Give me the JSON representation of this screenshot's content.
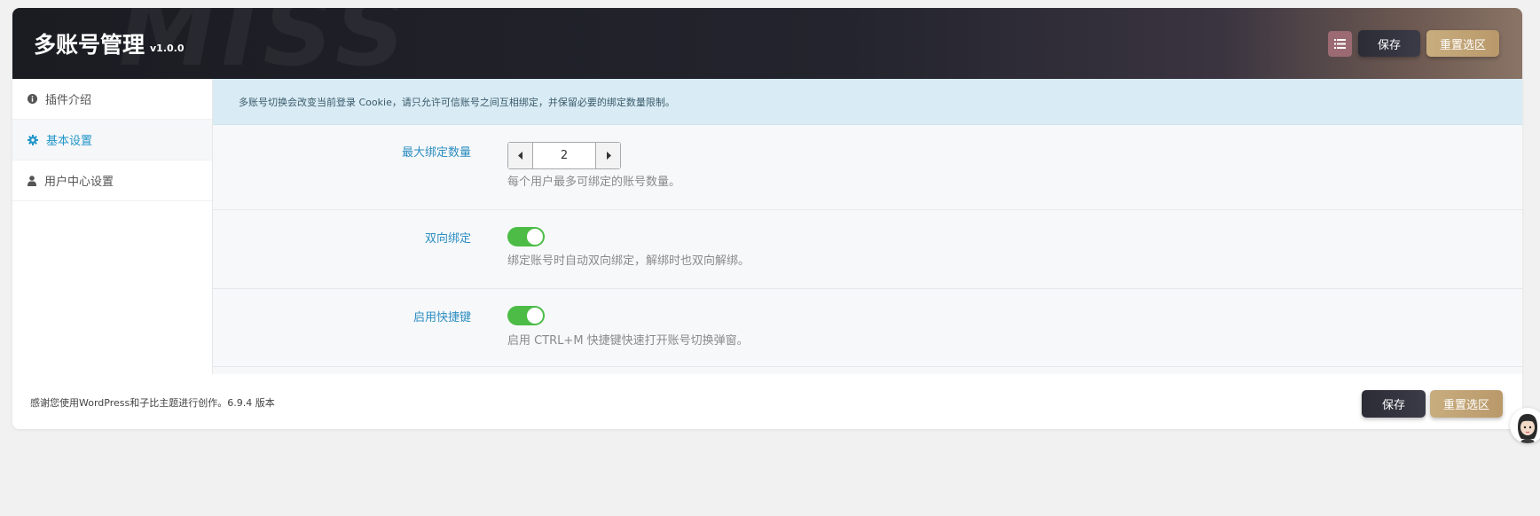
{
  "header": {
    "watermark": "MISS",
    "title": "多账号管理",
    "version": "v1.0.0",
    "save_label": "保存",
    "reset_label": "重置选区"
  },
  "sidebar": {
    "items": [
      {
        "label": "插件介绍",
        "icon": "info-circle-icon",
        "active": false
      },
      {
        "label": "基本设置",
        "icon": "gear-icon",
        "active": true
      },
      {
        "label": "用户中心设置",
        "icon": "user-icon",
        "active": false
      }
    ]
  },
  "main": {
    "notice": "多账号切换会改变当前登录 Cookie，请只允许可信账号之间互相绑定，并保留必要的绑定数量限制。",
    "fields": [
      {
        "label": "最大绑定数量",
        "value": "2",
        "description": "每个用户最多可绑定的账号数量。"
      },
      {
        "label": "双向绑定",
        "enabled": true,
        "description": "绑定账号时自动双向绑定，解绑时也双向解绑。"
      },
      {
        "label": "启用快捷键",
        "enabled": true,
        "description": "启用 CTRL+M 快捷键快速打开账号切换弹窗。"
      }
    ]
  },
  "footer": {
    "text": "感谢您使用WordPress和子比主题进行创作。6.9.4 版本",
    "save_label": "保存",
    "reset_label": "重置选区"
  },
  "colors": {
    "accent": "#2196c9",
    "toggle_on": "#4cbc47",
    "gold": "#c8ad7f",
    "dark": "#2b2c36"
  }
}
